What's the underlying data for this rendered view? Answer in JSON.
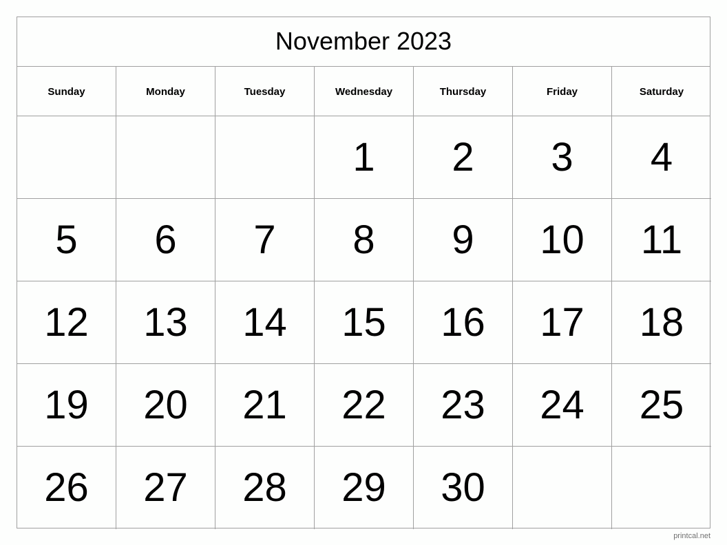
{
  "calendar": {
    "title": "November 2023",
    "weekdays": [
      "Sunday",
      "Monday",
      "Tuesday",
      "Wednesday",
      "Thursday",
      "Friday",
      "Saturday"
    ],
    "weeks": [
      [
        "",
        "",
        "",
        "1",
        "2",
        "3",
        "4"
      ],
      [
        "5",
        "6",
        "7",
        "8",
        "9",
        "10",
        "11"
      ],
      [
        "12",
        "13",
        "14",
        "15",
        "16",
        "17",
        "18"
      ],
      [
        "19",
        "20",
        "21",
        "22",
        "23",
        "24",
        "25"
      ],
      [
        "26",
        "27",
        "28",
        "29",
        "30",
        "",
        ""
      ]
    ]
  },
  "footer": {
    "watermark": "printcal.net"
  }
}
